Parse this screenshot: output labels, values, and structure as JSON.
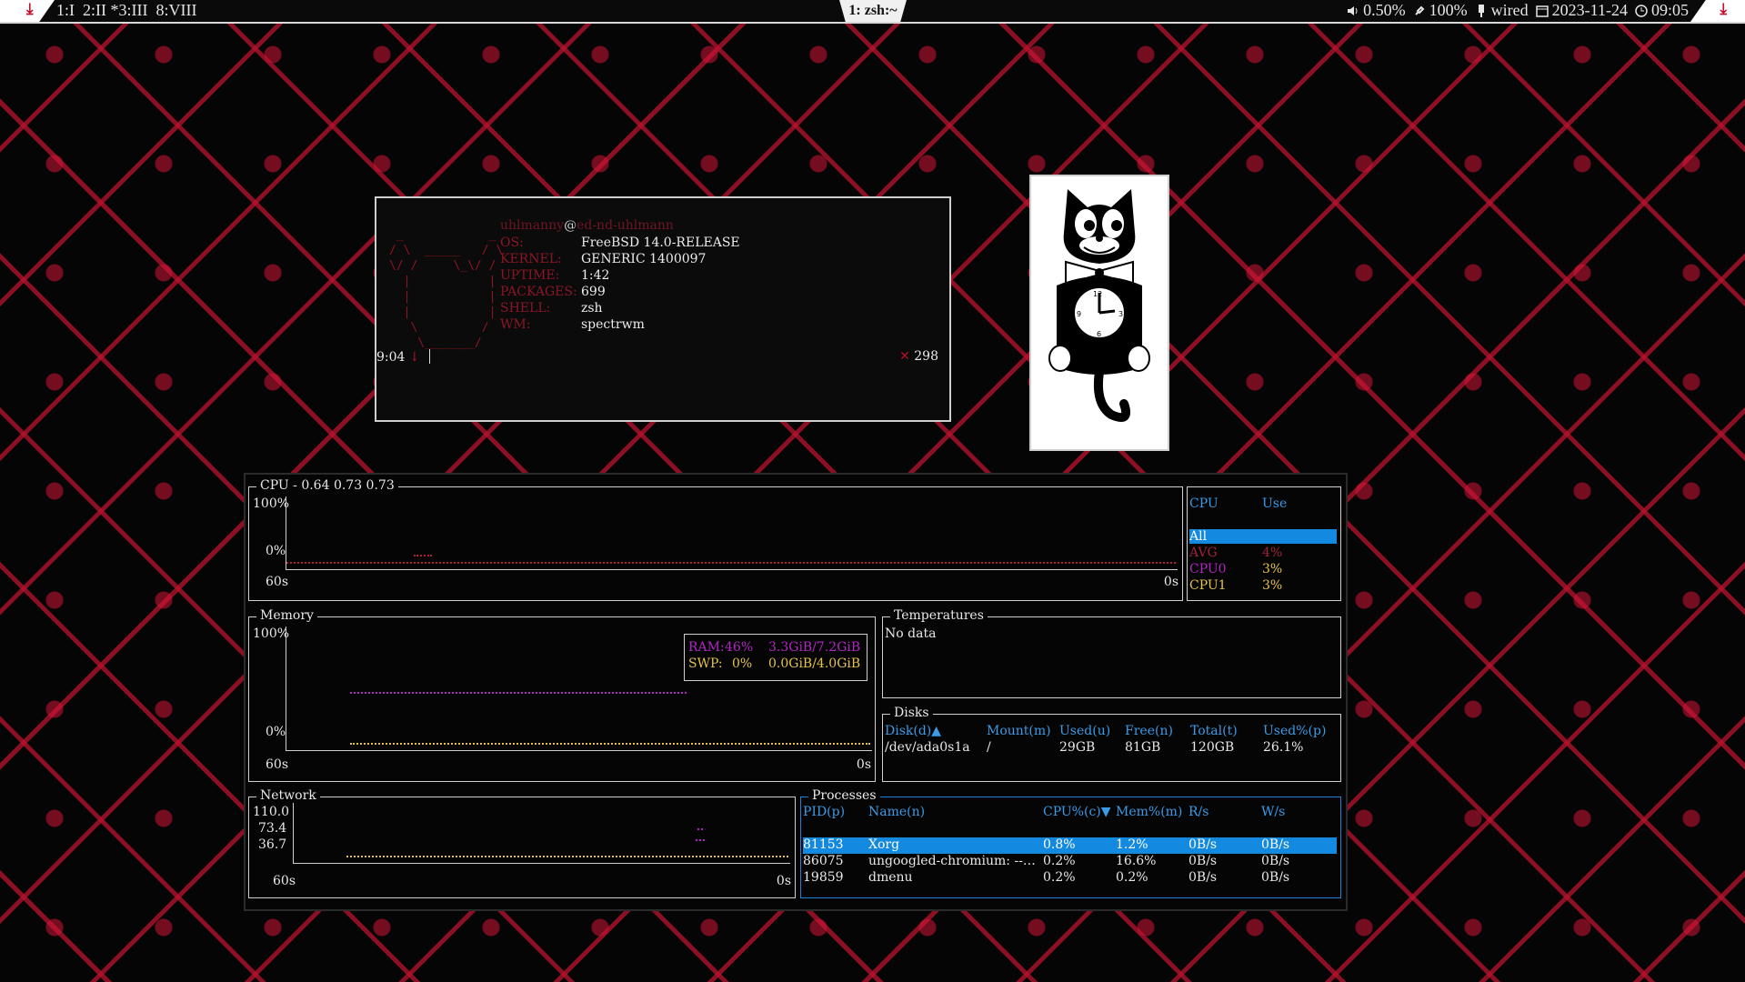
{
  "topbar": {
    "workspaces": "1:I  2:II *3:III  8:VIII",
    "window_title": "1: zsh:~",
    "volume": "0.50%",
    "battery": "100%",
    "network": "wired",
    "date": "2023-11-24",
    "time": "09:05",
    "menu_glyph": "⤓"
  },
  "fetch": {
    "user": "uhlmanny",
    "at": "@",
    "host": "ed-nd-uhlmann",
    "rows": [
      {
        "key": "OS:",
        "value": "FreeBSD 14.0-RELEASE"
      },
      {
        "key": "KERNEL:",
        "value": "GENERIC 1400097"
      },
      {
        "key": "UPTIME:",
        "value": "1:42"
      },
      {
        "key": "PACKAGES:",
        "value": "699"
      },
      {
        "key": "SHELL:",
        "value": "zsh"
      },
      {
        "key": "WM:",
        "value": "spectrwm"
      }
    ],
    "prompt_time": "9:04",
    "prompt_mark": "↓",
    "right_mark": "✕",
    "right_count": "298"
  },
  "btop": {
    "cpu": {
      "title": "CPU - 0.64 0.73 0.73",
      "y_top": "100%",
      "y_bottom": "0%",
      "x_left": "60s",
      "x_right": "0s"
    },
    "cpu_table": {
      "col_cpu": "CPU",
      "col_use": "Use",
      "rows": [
        {
          "name": "All",
          "use": "",
          "selected": true
        },
        {
          "name": "AVG",
          "use": "4%"
        },
        {
          "name": "CPU0",
          "use": "3%"
        },
        {
          "name": "CPU1",
          "use": "3%"
        }
      ]
    },
    "memory": {
      "title": "Memory",
      "y_top": "100%",
      "y_bottom": "0%",
      "x_left": "60s",
      "x_right": "0s",
      "ram_label": "RAM:",
      "ram_pct": "46%",
      "ram_val": "3.3GiB/7.2GiB",
      "swp_label": "SWP:",
      "swp_pct": "0%",
      "swp_val": "0.0GiB/4.0GiB"
    },
    "temperatures": {
      "title": "Temperatures",
      "text": "No data"
    },
    "disks": {
      "title": "Disks",
      "headers": [
        "Disk(d)▲",
        "Mount(m)",
        "Used(u)",
        "Free(n)",
        "Total(t)",
        "Used%(p)"
      ],
      "rows": [
        [
          "/dev/ada0s1a",
          "/",
          "29GB",
          "81GB",
          "120GB",
          "26.1%"
        ]
      ]
    },
    "network": {
      "title": "Network",
      "ticks": [
        "110.0",
        "73.4",
        "36.7"
      ],
      "x_left": "60s",
      "x_right": "0s"
    },
    "processes": {
      "title": "Processes",
      "headers": [
        "PID(p)",
        "Name(n)",
        "CPU%(c)▼",
        "Mem%(m)",
        "R/s",
        "W/s"
      ],
      "rows": [
        [
          "81153",
          "Xorg",
          "0.8%",
          "1.2%",
          "0B/s",
          "0B/s"
        ],
        [
          "86075",
          "ungoogled-chromium: --…",
          "0.2%",
          "16.6%",
          "0B/s",
          "0B/s"
        ],
        [
          "19859",
          "dmenu",
          "0.2%",
          "0.2%",
          "0B/s",
          "0B/s"
        ]
      ]
    }
  },
  "colors": {
    "accent": "#c2102f",
    "header_blue": "#3a9be8",
    "select_blue": "#1389e0",
    "mem_purple": "#b325c6",
    "swap_yellow": "#e6c24a"
  }
}
